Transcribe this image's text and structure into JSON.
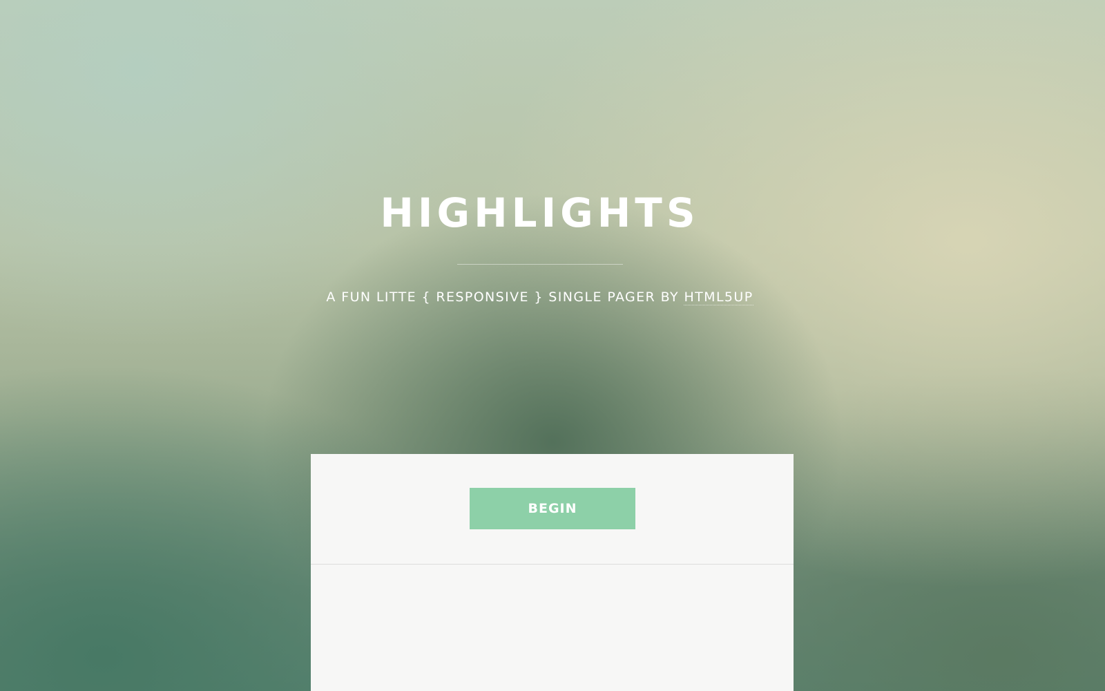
{
  "hero": {
    "title": "HIGHLIGHTS",
    "subtitle_prefix": "A FUN LITTE { RESPONSIVE } SINGLE PAGER BY ",
    "subtitle_link": "HTML5UP"
  },
  "panel": {
    "begin_label": "BEGIN"
  },
  "colors": {
    "button": "#8dd0a8",
    "panel_bg": "#f7f7f6",
    "text": "#ffffff"
  }
}
